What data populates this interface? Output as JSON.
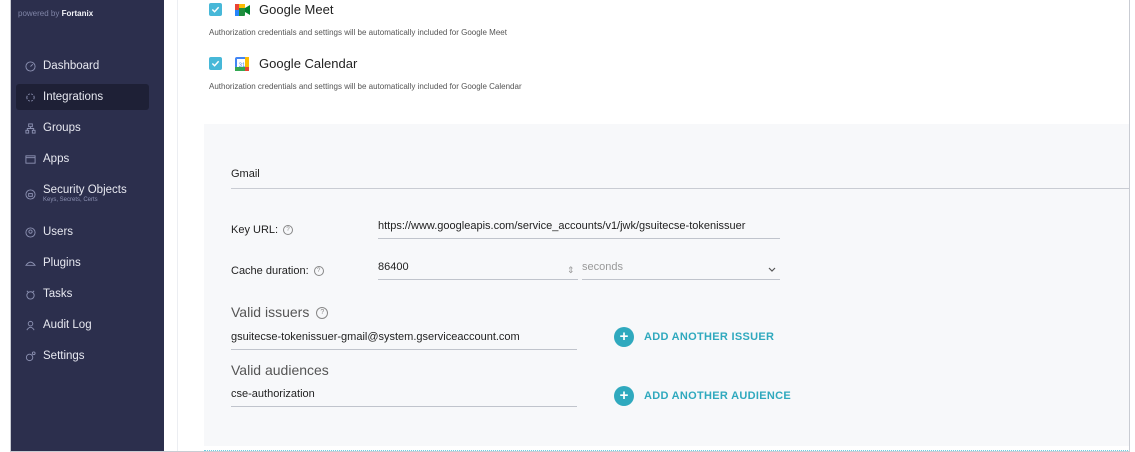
{
  "brand": {
    "prefix": "powered by",
    "name": "Fortanix"
  },
  "sidebar": {
    "items": [
      {
        "label": "Dashboard",
        "icon": "dashboard-icon"
      },
      {
        "label": "Integrations",
        "icon": "integrations-icon",
        "active": true
      },
      {
        "label": "Groups",
        "icon": "groups-icon"
      },
      {
        "label": "Apps",
        "icon": "apps-icon"
      },
      {
        "label": "Security Objects",
        "sublabel": "Keys, Secrets, Certs",
        "icon": "security-objects-icon"
      },
      {
        "label": "Users",
        "icon": "users-icon"
      },
      {
        "label": "Plugins",
        "icon": "plugins-icon"
      },
      {
        "label": "Tasks",
        "icon": "tasks-icon"
      },
      {
        "label": "Audit Log",
        "icon": "audit-log-icon"
      },
      {
        "label": "Settings",
        "icon": "settings-icon"
      }
    ]
  },
  "apps": [
    {
      "name": "Google Meet",
      "checked": true,
      "hint": "Authorization credentials and settings will be automatically included for Google Meet"
    },
    {
      "name": "Google Calendar",
      "checked": true,
      "hint": "Authorization credentials and settings will be automatically included for Google Calendar"
    }
  ],
  "gmail": {
    "title": "Gmail",
    "key_url_label": "Key URL:",
    "key_url_value": "https://www.googleapis.com/service_accounts/v1/jwk/gsuitecse-tokenissuer",
    "cache_label": "Cache duration:",
    "cache_value": "86400",
    "cache_unit": "seconds",
    "issuers_label": "Valid issuers",
    "issuer_value": "gsuitecse-tokenissuer-gmail@system.gserviceaccount.com",
    "add_issuer": "ADD ANOTHER ISSUER",
    "audiences_label": "Valid audiences",
    "audience_value": "cse-authorization",
    "add_audience": "ADD ANOTHER AUDIENCE"
  },
  "colors": {
    "sidebar_bg": "#2c2f4d",
    "accent": "#2fa9be",
    "checkbox": "#47b8d8"
  }
}
